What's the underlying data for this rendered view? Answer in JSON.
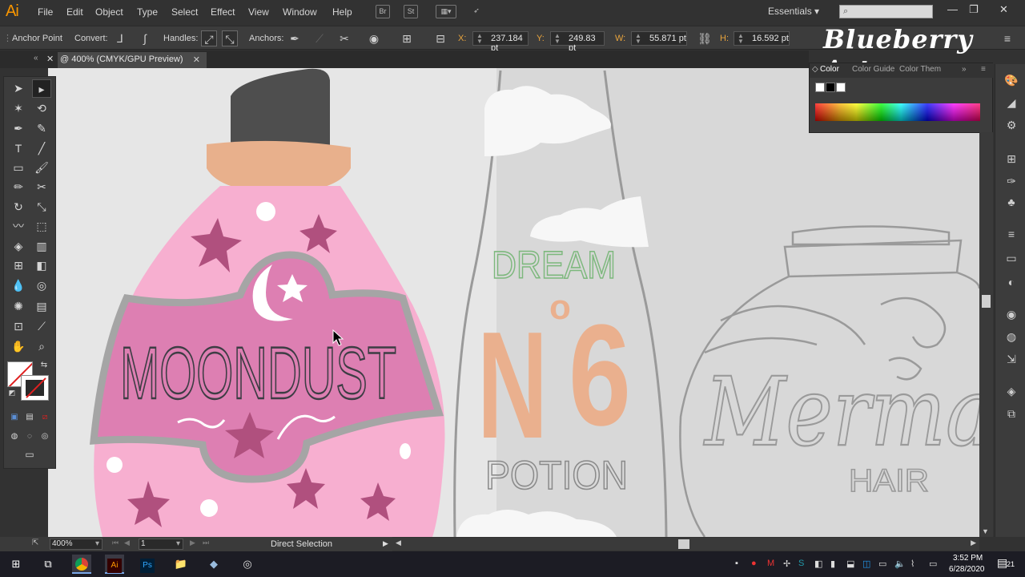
{
  "app": {
    "logo": "Ai",
    "menu": [
      "File",
      "Edit",
      "Object",
      "Type",
      "Select",
      "Effect",
      "View",
      "Window",
      "Help"
    ],
    "bridge_label": "Br",
    "stock_label": "St",
    "workspace": "Essentials",
    "window_controls": [
      "—",
      "❐",
      "✕"
    ]
  },
  "control_bar": {
    "mode": "Anchor Point",
    "convert_label": "Convert:",
    "handles_label": "Handles:",
    "anchors_label": "Anchors:",
    "x_label": "X:",
    "x_value": "237.184 pt",
    "y_label": "Y:",
    "y_value": "249.83 pt",
    "w_label": "W:",
    "w_value": "55.871 pt",
    "h_label": "H:",
    "h_value": "16.592 pt"
  },
  "brand": "Blueberry Art",
  "document": {
    "tab_title": "@ 400% (CMYK/GPU Preview)",
    "close": "✕"
  },
  "artwork": {
    "moondust": "MOONDUST",
    "dream": "DREAM",
    "n6_n": "N",
    "n6_o": "o",
    "n6_6": "6",
    "potion": "POTION",
    "mermaid": "Merma",
    "hair": "HAIR",
    "colors": {
      "bottle_pink": "#f7afd0",
      "label_pink": "#dd7fb2",
      "star": "#b0507e",
      "cork": "#e8b08c",
      "cap": "#4e4e4e",
      "ring": "#a5a5a5",
      "canvas": "#d8d8d8",
      "peach": "#eab08e",
      "dream_green": "#7db87d"
    }
  },
  "status_bar": {
    "zoom": "400%",
    "page": "1",
    "tool": "Direct Selection"
  },
  "color_panel": {
    "tabs": [
      "Color",
      "Color Guide",
      "Color Them"
    ]
  },
  "taskbar": {
    "time": "3:52 PM",
    "date": "6/28/2020",
    "notifications": "21"
  }
}
